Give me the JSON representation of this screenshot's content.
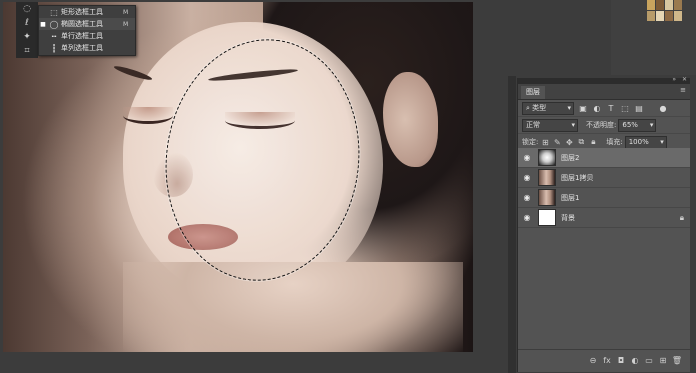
{
  "tools": {
    "flyout_items": [
      {
        "label": "矩形选框工具",
        "key": "M",
        "icon": "rect-marquee-icon",
        "active": false
      },
      {
        "label": "椭圆选框工具",
        "key": "M",
        "icon": "ellipse-marquee-icon",
        "active": true
      },
      {
        "label": "单行选框工具",
        "key": "",
        "icon": "single-row-marquee-icon",
        "active": false
      },
      {
        "label": "单列选框工具",
        "key": "",
        "icon": "single-column-marquee-icon",
        "active": false
      }
    ]
  },
  "layers_panel": {
    "tab_label": "图层",
    "filter_label": "类型",
    "blend_mode": "正常",
    "opacity_label": "不透明度:",
    "opacity_value": "65%",
    "lock_label": "锁定:",
    "fill_label": "填充:",
    "fill_value": "100%",
    "layers": [
      {
        "name": "图层2",
        "selected": true,
        "thumb": "gradient-white",
        "locked": false
      },
      {
        "name": "图层1拷贝",
        "selected": false,
        "thumb": "face-photo",
        "locked": false
      },
      {
        "name": "图层1",
        "selected": false,
        "thumb": "face-photo",
        "locked": false
      },
      {
        "name": "背景",
        "selected": false,
        "thumb": "white",
        "locked": true
      }
    ]
  },
  "colors": {
    "panel_bg": "#535353",
    "selected_row": "#6a6a6a",
    "workspace": "#3c3c3c",
    "swatches": [
      "#c9a45e",
      "#7c5a36",
      "#d8c7a0",
      "#9a7a4f",
      "#b89c6a",
      "#e5d6b5"
    ]
  }
}
